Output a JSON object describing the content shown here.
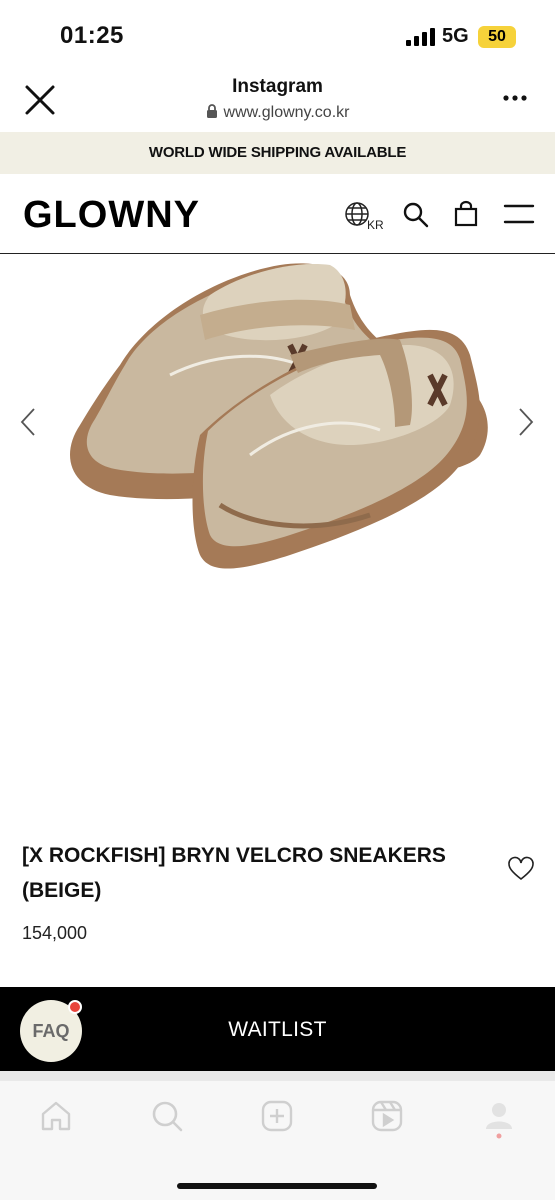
{
  "status_bar": {
    "time": "01:25",
    "network": "5G",
    "battery": "50"
  },
  "browser": {
    "title": "Instagram",
    "url": "www.glowny.co.kr"
  },
  "banner": {
    "text": "WORLD WIDE SHIPPING AVAILABLE"
  },
  "site": {
    "logo": "GLOWNY",
    "region": "KR"
  },
  "product": {
    "title": "[X ROCKFISH] BRYN VELCRO SNEAKERS (BEIGE)",
    "price": "154,000"
  },
  "actions": {
    "waitlist_label": "WAITLIST",
    "faq_label": "FAQ"
  },
  "colors": {
    "banner_bg": "#f1efe4",
    "cta_bg": "#000000",
    "badge": "#e8453c",
    "battery": "#f6d23a"
  },
  "icons": [
    "close-icon",
    "lock-icon",
    "more-icon",
    "globe-icon",
    "search-icon",
    "bag-icon",
    "menu-icon",
    "chevron-left-icon",
    "chevron-right-icon",
    "heart-icon",
    "home-icon",
    "explore-icon",
    "create-icon",
    "reels-icon",
    "profile-icon"
  ]
}
